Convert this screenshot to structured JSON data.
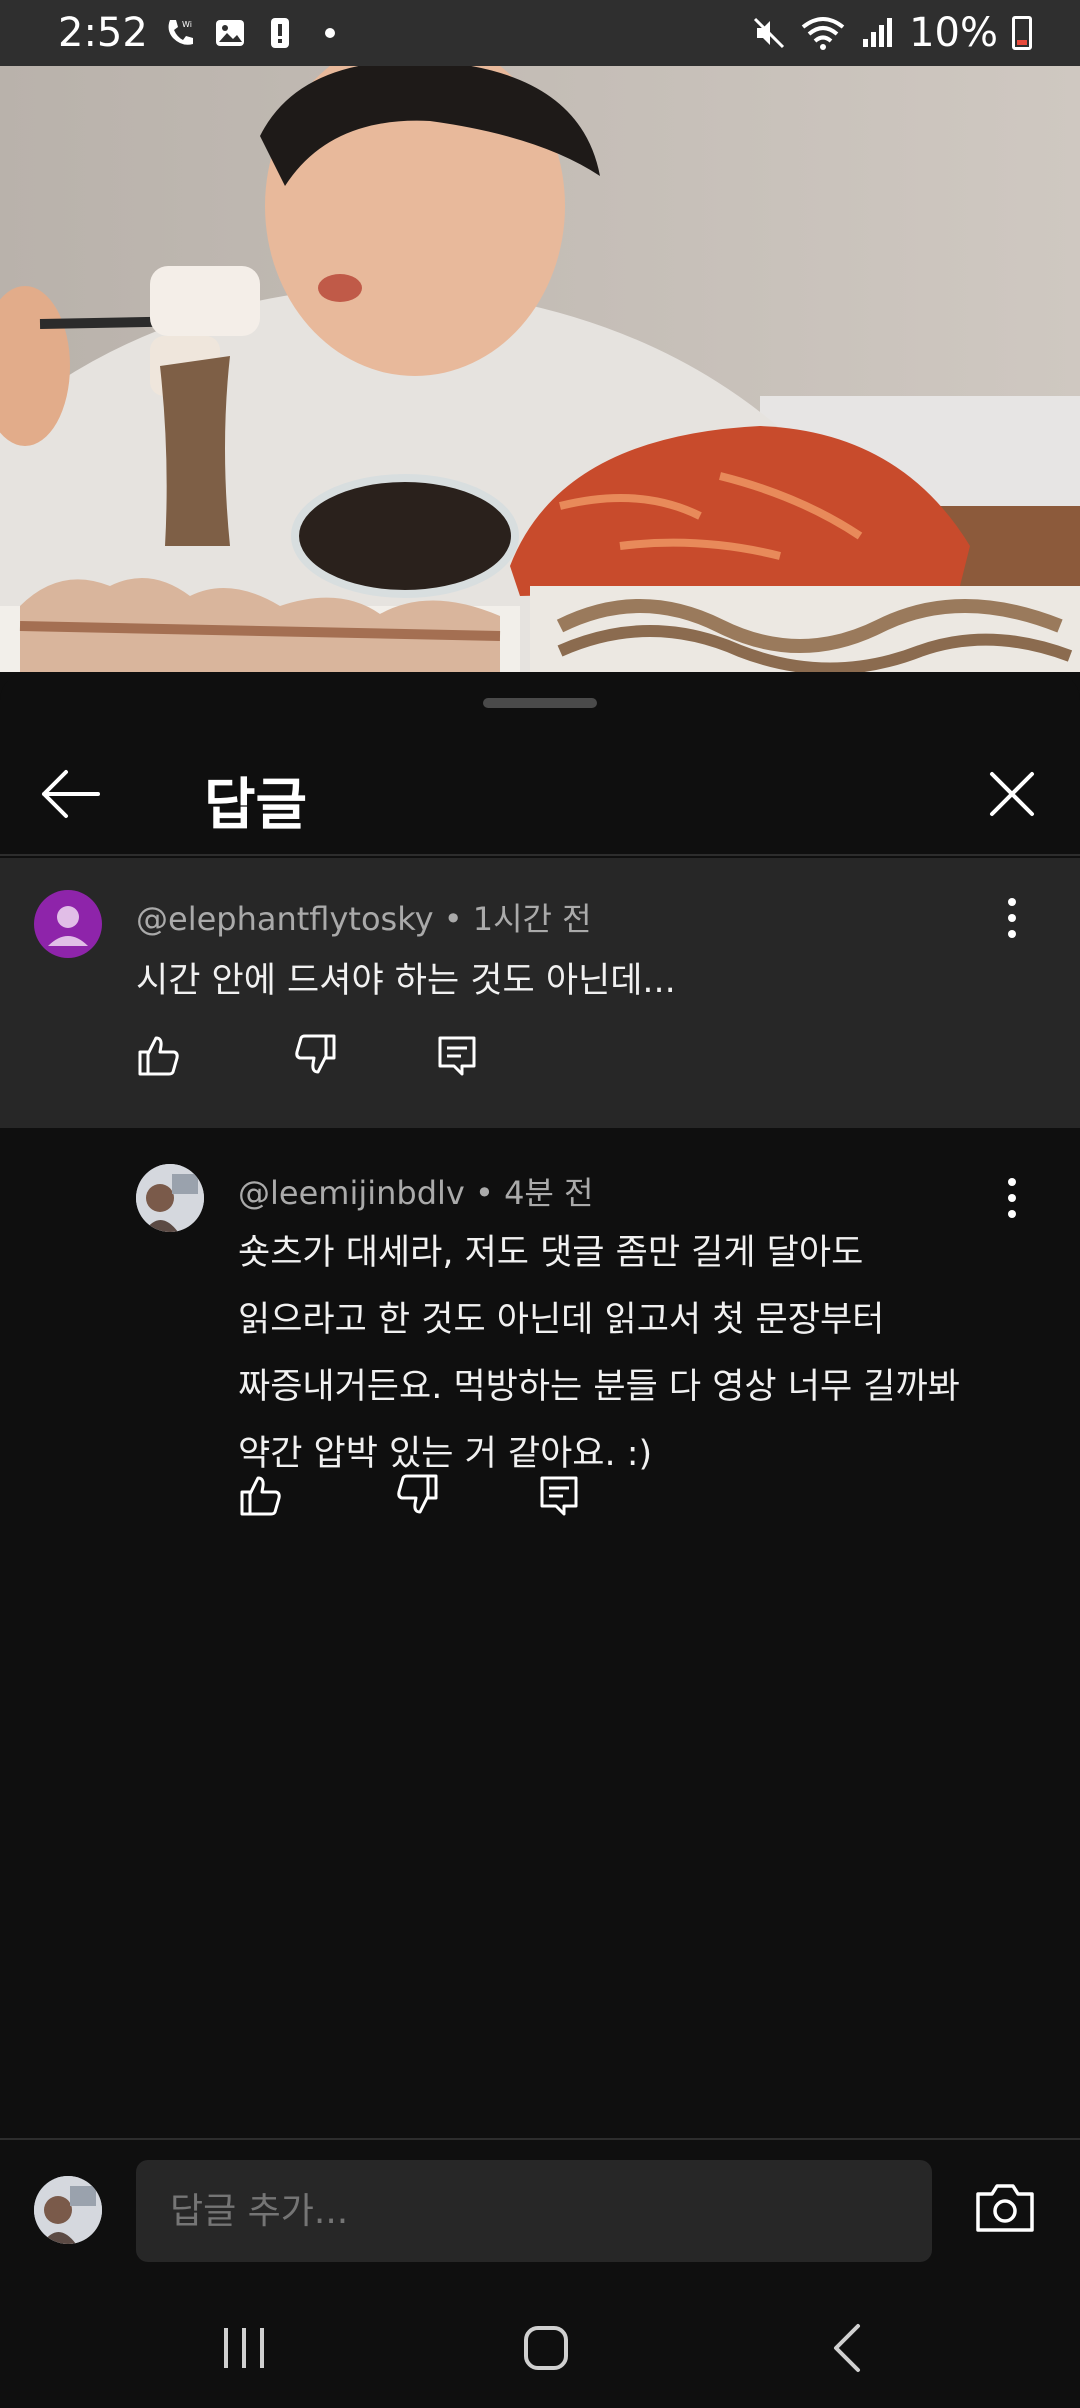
{
  "status_bar": {
    "time": "2:52",
    "battery_percent": "10%",
    "icons": [
      "wifi-calling-icon",
      "gallery-icon",
      "alert-icon",
      "dot-icon",
      "mute-icon",
      "wifi-icon",
      "signal-icon",
      "battery-icon"
    ]
  },
  "sheet": {
    "title": "답글"
  },
  "parent_comment": {
    "author": "@elephantflytosky",
    "time": "1시간 전",
    "text": "시간 안에 드셔야 하는 것도 아닌데..."
  },
  "reply": {
    "author": "@leemijinbdlv",
    "time": "4분 전",
    "lines": [
      "숏츠가 대세라, 저도 댓글 좀만 길게 달아도",
      "읽으라고 한 것도 아닌데 읽고서 첫 문장부터",
      "짜증내거든요. 먹방하는 분들 다 영상 너무 길까봐",
      "약간 압박 있는 거 같아요. :)"
    ]
  },
  "composer": {
    "placeholder": "답글 추가..."
  },
  "separator": "•",
  "colors": {
    "background": "#0f0f0f",
    "highlight": "#272727",
    "avatar_purple": "#8e24aa",
    "battery_low": "#e84a3c"
  }
}
